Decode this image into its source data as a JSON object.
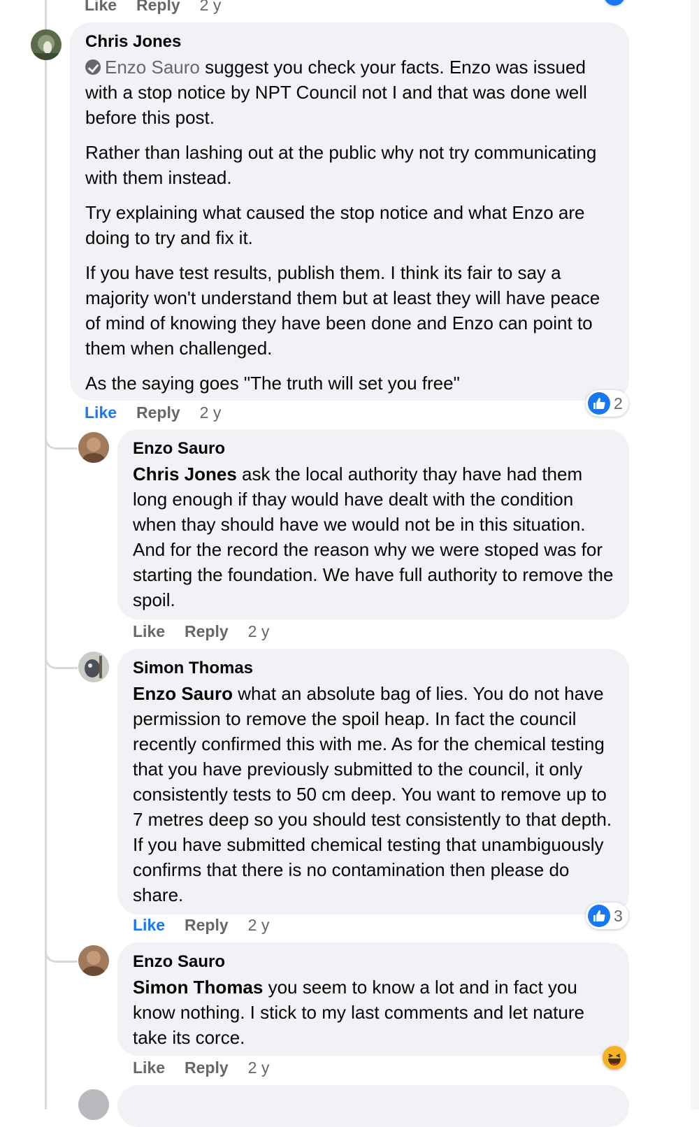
{
  "top_partial": {
    "like": "Like",
    "reply": "Reply",
    "time": "2 y"
  },
  "comments": [
    {
      "author": "Chris Jones",
      "mention": "Enzo Sauro",
      "paragraphs": [
        " suggest you check your facts. Enzo was issued with a stop notice by NPT Council not I and that was done well before this post.",
        "Rather than lashing out at the public why not try communicating with them instead.",
        "Try explaining what caused the stop notice and what Enzo are doing to try and fix it.",
        "If you have test results, publish them. I think its fair to say a majority won't understand them but at least they will have peace of mind of knowing they have been done and Enzo can point to them when challenged.",
        "As the saying goes \"The truth will set you free\""
      ],
      "actions": {
        "like": "Like",
        "reply": "Reply",
        "time": "2 y"
      },
      "reaction_count": "2"
    },
    {
      "author": "Enzo Sauro",
      "mention": "Chris Jones",
      "text": " ask the local authority thay have had them long enough if thay would have dealt with the condition when thay should have we would not be in this situation. And for the record the reason why we were stoped was for starting the foundation. We have full authority to remove the spoil.",
      "actions": {
        "like": "Like",
        "reply": "Reply",
        "time": "2 y"
      }
    },
    {
      "author": "Simon Thomas",
      "mention": "Enzo Sauro",
      "text": " what an absolute bag of lies. You do not have permission to remove the spoil heap. In fact the council recently confirmed this with me. As for the chemical testing that you have previously submitted to the council, it only consistently tests to 50 cm deep. You want to remove up to 7 metres deep so you should test consistently to that depth. If you have submitted chemical testing that unambiguously confirms that there is no contamination then please do share.",
      "actions": {
        "like": "Like",
        "reply": "Reply",
        "time": "2 y"
      },
      "reaction_count": "3"
    },
    {
      "author": "Enzo Sauro",
      "mention": "Simon Thomas",
      "text": " you seem to know a lot and in fact you know nothing. I stick to my last comments and let nature take its corce.",
      "actions": {
        "like": "Like",
        "reply": "Reply",
        "time": "2 y"
      }
    }
  ],
  "colors": {
    "bubble": "#f0f2f5",
    "meta": "#65676b",
    "liked": "#1877f2",
    "text": "#050505"
  }
}
